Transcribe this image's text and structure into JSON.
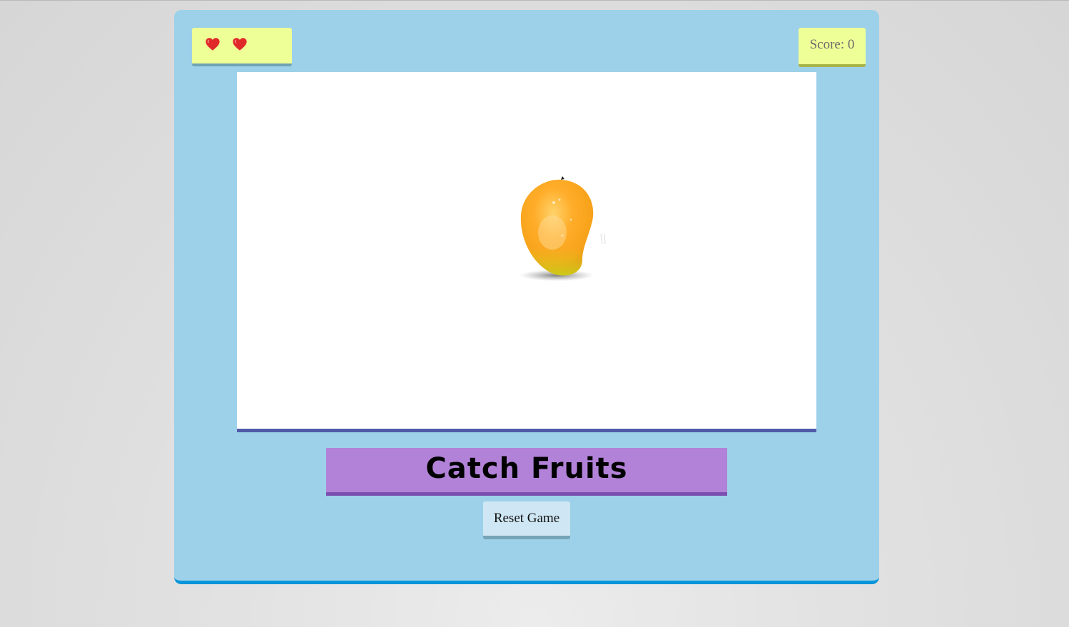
{
  "game": {
    "title": "Catch Fruits",
    "lives": 2,
    "score_label": "Score: 0",
    "reset_label": "Reset Game",
    "falling_item": "mango",
    "hearts": [
      "heart-icon",
      "heart-icon"
    ]
  },
  "colors": {
    "frame": "#9dd1e9",
    "frame_border": "#0a95db",
    "panel": "#efff97",
    "title_banner": "#b282d8",
    "play_area": "#ffffff",
    "heart": "#e02a2a"
  }
}
